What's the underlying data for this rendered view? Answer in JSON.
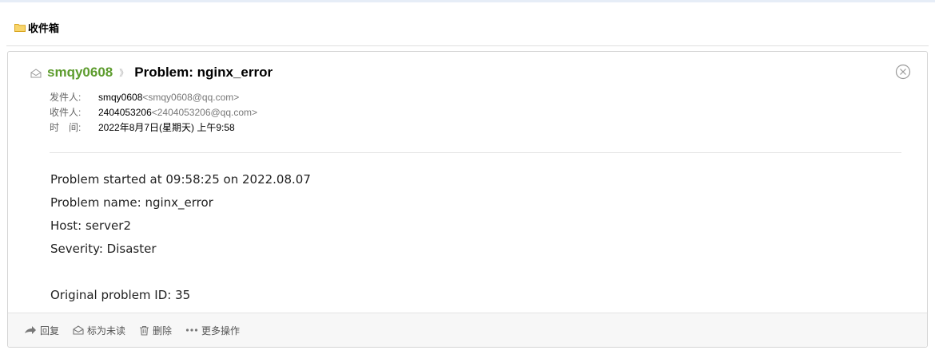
{
  "folder": {
    "title": "收件箱",
    "icon": "folder-icon"
  },
  "mail": {
    "sender": "smqy0608",
    "separator": "》",
    "subject": "Problem: nginx_error",
    "from": {
      "label": "发件人:",
      "name": "smqy0608",
      "email": "<smqy0608@qq.com>"
    },
    "to": {
      "label": "收件人:",
      "name": "2404053206",
      "email": "<2404053206@qq.com>"
    },
    "time": {
      "label": "时　间:",
      "value": "2022年8月7日(星期天) 上午9:58"
    },
    "body": {
      "line1": "Problem started at 09:58:25 on 2022.08.07",
      "line2": "Problem name: nginx_error",
      "line3": "Host: server2",
      "line4": "Severity: Disaster",
      "line5": "Original problem ID: 35"
    }
  },
  "actions": {
    "reply": "回复",
    "mark_unread": "标为未读",
    "delete": "删除",
    "more": "更多操作"
  },
  "colors": {
    "sender": "#5d9c2e",
    "folder": "#f5c342"
  }
}
